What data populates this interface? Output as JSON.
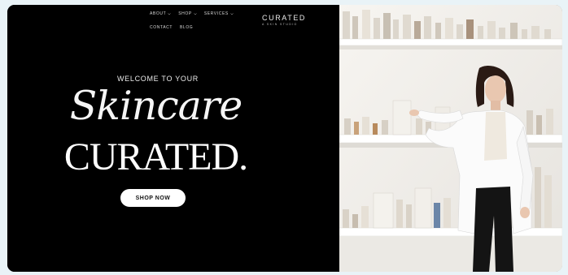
{
  "nav": {
    "row1": [
      {
        "label": "ABOUT",
        "dropdown": true
      },
      {
        "label": "SHOP",
        "dropdown": true
      },
      {
        "label": "SERVICES",
        "dropdown": true
      }
    ],
    "row2": [
      {
        "label": "CONTACT",
        "dropdown": false
      },
      {
        "label": "BLOG",
        "dropdown": false
      }
    ]
  },
  "logo": {
    "main": "CURATED",
    "sub": "A SKIN STUDIO"
  },
  "hero": {
    "welcome": "WELCOME TO YOUR",
    "script": "Skincare",
    "headline": "CURATED.",
    "cta": "SHOP NOW"
  },
  "colors": {
    "background": "#000000",
    "text": "#ffffff",
    "button": "#ffffff",
    "page_bg": "#e9f3f7"
  }
}
